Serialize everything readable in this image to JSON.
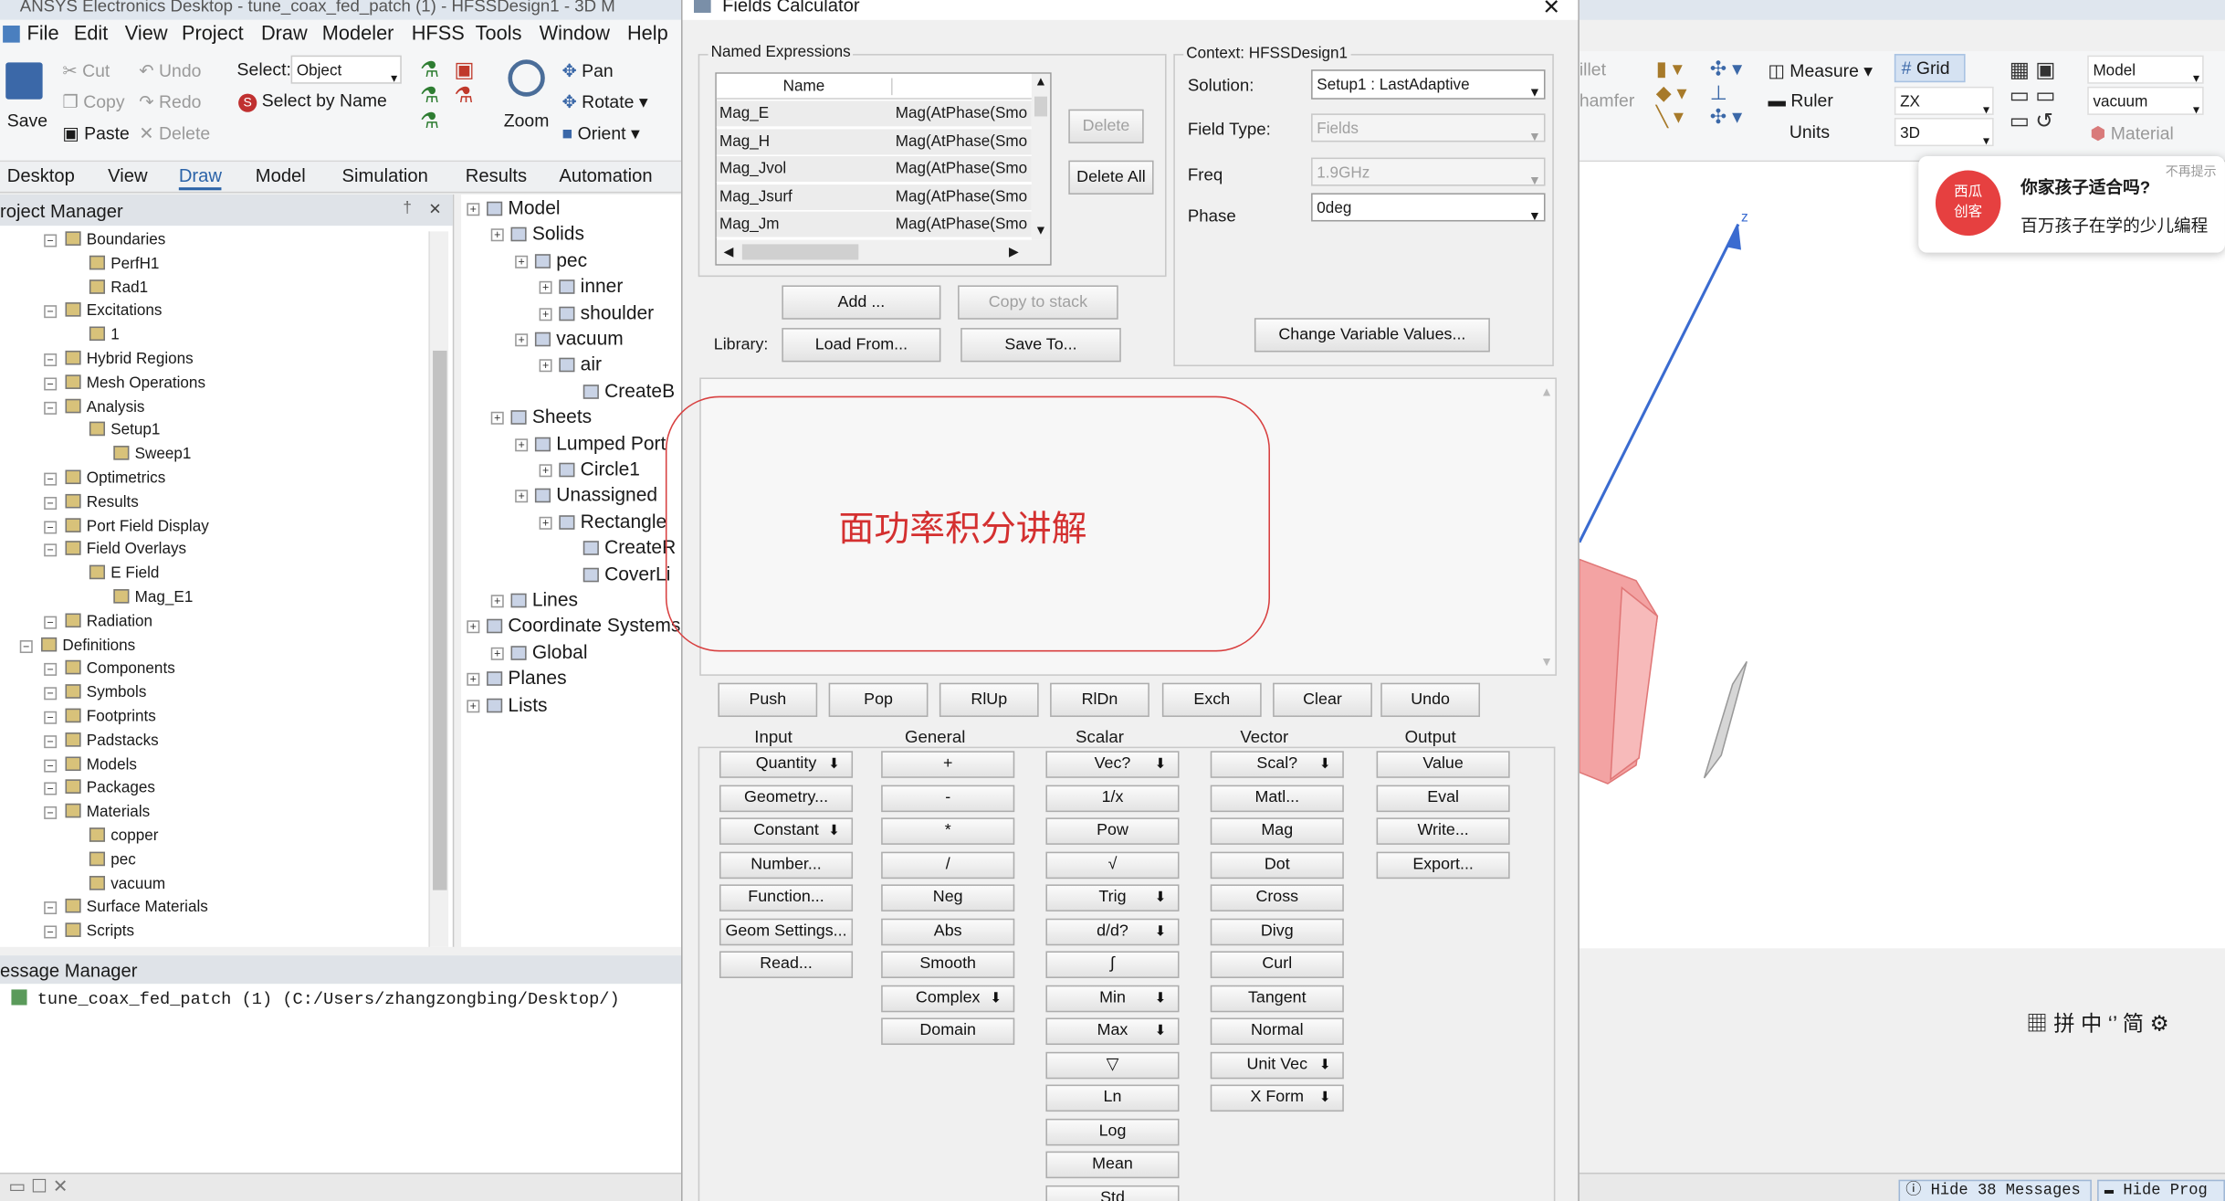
{
  "window": {
    "title": "ANSYS Electronics Desktop - tune_coax_fed_patch (1) - HFSSDesign1 - 3D M"
  },
  "menu": [
    "File",
    "Edit",
    "View",
    "Project",
    "Draw",
    "Modeler",
    "HFSS",
    "Tools",
    "Window",
    "Help"
  ],
  "ribbon": {
    "save": "Save",
    "cut": "Cut",
    "copy": "Copy",
    "paste": "Paste",
    "undo": "Undo",
    "redo": "Redo",
    "delete": "Delete",
    "select_label": "Select:",
    "select_value": "Object",
    "select_by_name": "Select by Name",
    "zoom": "Zoom",
    "pan": "Pan",
    "rotate": "Rotate",
    "orient": "Orient"
  },
  "tabs": [
    "Desktop",
    "View",
    "Draw",
    "Model",
    "Simulation",
    "Results",
    "Automation"
  ],
  "active_tab": "Draw",
  "project_manager": {
    "title": "roject Manager",
    "pin": "†",
    "close": "✕",
    "items": [
      {
        "label": "Boundaries",
        "level": 2
      },
      {
        "label": "PerfH1",
        "level": 3
      },
      {
        "label": "Rad1",
        "level": 3
      },
      {
        "label": "Excitations",
        "level": 2
      },
      {
        "label": "1",
        "level": 3
      },
      {
        "label": "Hybrid Regions",
        "level": 2
      },
      {
        "label": "Mesh Operations",
        "level": 2
      },
      {
        "label": "Analysis",
        "level": 2
      },
      {
        "label": "Setup1",
        "level": 3
      },
      {
        "label": "Sweep1",
        "level": 4
      },
      {
        "label": "Optimetrics",
        "level": 2
      },
      {
        "label": "Results",
        "level": 2
      },
      {
        "label": "Port Field Display",
        "level": 2
      },
      {
        "label": "Field Overlays",
        "level": 2
      },
      {
        "label": "E Field",
        "level": 3
      },
      {
        "label": "Mag_E1",
        "level": 4
      },
      {
        "label": "Radiation",
        "level": 2
      },
      {
        "label": "Definitions",
        "level": 1
      },
      {
        "label": "Components",
        "level": 2
      },
      {
        "label": "Symbols",
        "level": 2
      },
      {
        "label": "Footprints",
        "level": 2
      },
      {
        "label": "Padstacks",
        "level": 2
      },
      {
        "label": "Models",
        "level": 2
      },
      {
        "label": "Packages",
        "level": 2
      },
      {
        "label": "Materials",
        "level": 2
      },
      {
        "label": "copper",
        "level": 3
      },
      {
        "label": "pec",
        "level": 3
      },
      {
        "label": "vacuum",
        "level": 3
      },
      {
        "label": "Surface Materials",
        "level": 2
      },
      {
        "label": "Scripts",
        "level": 2
      }
    ]
  },
  "model_tree": [
    {
      "label": "Model",
      "level": 0
    },
    {
      "label": "Solids",
      "level": 1
    },
    {
      "label": "pec",
      "level": 2
    },
    {
      "label": "inner",
      "level": 3
    },
    {
      "label": "shoulder",
      "level": 3
    },
    {
      "label": "vacuum",
      "level": 2
    },
    {
      "label": "air",
      "level": 3
    },
    {
      "label": "CreateB",
      "level": 4
    },
    {
      "label": "Sheets",
      "level": 1
    },
    {
      "label": "Lumped Port",
      "level": 2
    },
    {
      "label": "Circle1",
      "level": 3
    },
    {
      "label": "Unassigned",
      "level": 2
    },
    {
      "label": "Rectangle",
      "level": 3
    },
    {
      "label": "CreateR",
      "level": 4
    },
    {
      "label": "CoverLi",
      "level": 4
    },
    {
      "label": "Lines",
      "level": 1
    },
    {
      "label": "Coordinate Systems",
      "level": 0
    },
    {
      "label": "Global",
      "level": 1
    },
    {
      "label": "Planes",
      "level": 0
    },
    {
      "label": "Lists",
      "level": 0
    }
  ],
  "message_manager": {
    "title": "essage Manager",
    "line": "tune_coax_fed_patch (1)  (C:/Users/zhangzongbing/Desktop/)"
  },
  "status_bar": {
    "hide_messages": "Hide 38 Messages",
    "hide_progress": "Hide Prog"
  },
  "dialog": {
    "title": "Fields Calculator",
    "named_expressions_label": "Named Expressions",
    "columns": [
      "Name",
      ""
    ],
    "expressions": [
      {
        "name": "Mag_E",
        "expr": "Mag(AtPhase(Smo"
      },
      {
        "name": "Mag_H",
        "expr": "Mag(AtPhase(Smo"
      },
      {
        "name": "Mag_Jvol",
        "expr": "Mag(AtPhase(Smo"
      },
      {
        "name": "Mag_Jsurf",
        "expr": "Mag(AtPhase(Smo"
      },
      {
        "name": "Mag_Jm",
        "expr": "Mag(AtPhase(Smo"
      }
    ],
    "delete": "Delete",
    "delete_all": "Delete All",
    "add": "Add ...",
    "copy_to_stack": "Copy to stack",
    "library": "Library:",
    "load_from": "Load From...",
    "save_to": "Save To...",
    "context": "Context: HFSSDesign1",
    "solution_label": "Solution:",
    "solution": "Setup1 : LastAdaptive",
    "field_type_label": "Field Type:",
    "field_type": "Fields",
    "freq_label": "Freq",
    "freq": "1.9GHz",
    "phase_label": "Phase",
    "phase": "0deg",
    "change_vars": "Change Variable Values...",
    "overlay_text": "面功率积分讲解",
    "stack_buttons": [
      "Push",
      "Pop",
      "RlUp",
      "RlDn",
      "Exch",
      "Clear",
      "Undo"
    ],
    "categories": [
      "Input",
      "General",
      "Scalar",
      "Vector",
      "Output"
    ],
    "input": [
      "Quantity",
      "Geometry...",
      "Constant",
      "Number...",
      "Function...",
      "Geom Settings...",
      "Read..."
    ],
    "general": [
      "+",
      "-",
      "*",
      "/",
      "Neg",
      "Abs",
      "Smooth",
      "Complex",
      "Domain"
    ],
    "scalar": [
      "Vec?",
      "1/x",
      "Pow",
      "√",
      "Trig",
      "d/d?",
      "∫",
      "Min",
      "Max",
      "▽",
      "Ln",
      "Log",
      "Mean",
      "Std"
    ],
    "vector": [
      "Scal?",
      "Matl...",
      "Mag",
      "Dot",
      "Cross",
      "Divg",
      "Curl",
      "Tangent",
      "Normal",
      "Unit Vec",
      "X Form"
    ],
    "output": [
      "Value",
      "Eval",
      "Write...",
      "Export..."
    ]
  },
  "right_toolbar": {
    "fillet": "illet",
    "chamfer": "hamfer",
    "measure": "Measure",
    "ruler": "Ruler",
    "units": "Units",
    "grid": "Grid",
    "plane": "ZX",
    "dim": "3D",
    "model_sel": "Model",
    "material_sel": "vacuum",
    "material": "Material"
  },
  "ad": {
    "line1": "你家孩子适合吗?",
    "line2": "百万孩子在学的少儿编程",
    "close": "不再提示",
    "logo": "西瓜\n创客"
  },
  "ime": "拼 中 ‘’ 简"
}
